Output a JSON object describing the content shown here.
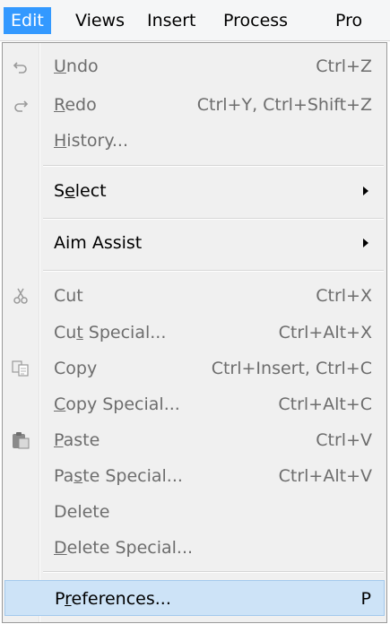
{
  "menubar": {
    "items": [
      {
        "label": "Edit",
        "active": true
      },
      {
        "label": "Views"
      },
      {
        "label": "Insert"
      },
      {
        "label": "Process"
      },
      {
        "label": "Pro"
      }
    ]
  },
  "menu": {
    "undo": {
      "label": "Undo",
      "mnemonic": "U",
      "shortcut": "Ctrl+Z",
      "icon": "undo-icon"
    },
    "redo": {
      "label": "Redo",
      "mnemonic": "R",
      "shortcut": "Ctrl+Y, Ctrl+Shift+Z",
      "icon": "redo-icon"
    },
    "history": {
      "label": "History...",
      "mnemonic": "H"
    },
    "select": {
      "label": "Select",
      "mnemonic": "e"
    },
    "aim_assist": {
      "label": "Aim Assist"
    },
    "cut": {
      "label": "Cut",
      "shortcut": "Ctrl+X",
      "icon": "scissors-icon"
    },
    "cut_special": {
      "label": "Cut Special...",
      "mnemonic": "t",
      "shortcut": "Ctrl+Alt+X"
    },
    "copy": {
      "label": "Copy",
      "shortcut": "Ctrl+Insert, Ctrl+C",
      "icon": "copy-icon"
    },
    "copy_special": {
      "label": "Copy Special...",
      "mnemonic": "C",
      "shortcut": "Ctrl+Alt+C"
    },
    "paste": {
      "label": "Paste",
      "mnemonic": "P",
      "shortcut": "Ctrl+V",
      "icon": "paste-icon"
    },
    "paste_special": {
      "label": "Paste Special...",
      "mnemonic": "s",
      "shortcut": "Ctrl+Alt+V"
    },
    "delete": {
      "label": "Delete"
    },
    "delete_special": {
      "label": "Delete Special...",
      "mnemonic": "D"
    },
    "preferences": {
      "label": "Preferences...",
      "mnemonic": "r",
      "shortcut": "P"
    }
  },
  "colors": {
    "menu_active": "#3399ff",
    "highlight_bg": "#cde3f7",
    "disabled_text": "#6d6d6d"
  }
}
